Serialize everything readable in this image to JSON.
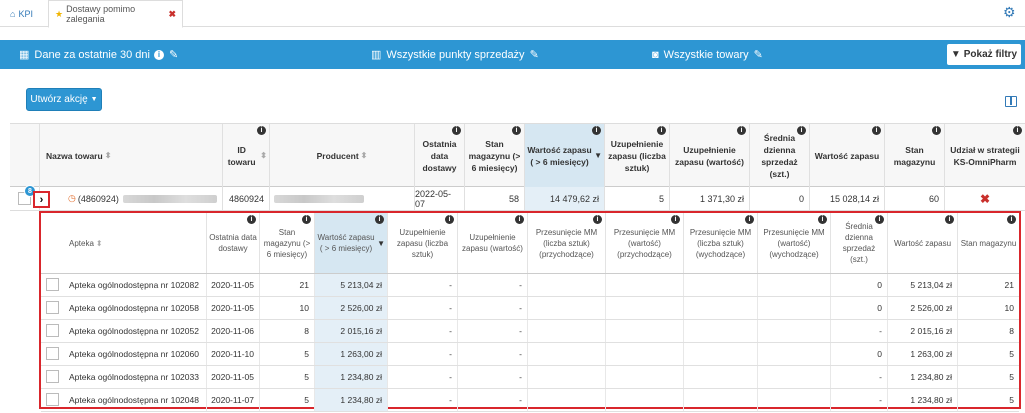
{
  "tabs": [
    {
      "icon": "home-icon",
      "label": "KPI"
    },
    {
      "icon": "star-icon",
      "label": "Dostawy pomimo zalegania"
    }
  ],
  "filterbar": {
    "period": "Dane za ostatnie 30 dni",
    "points": "Wszystkie punkty sprzedaży",
    "products": "Wszystkie towary",
    "show_filters": "Pokaż filtry"
  },
  "action_button": "Utwórz akcję",
  "main_table": {
    "headers": [
      "Nazwa towaru",
      "ID towaru",
      "Producent",
      "Ostatnia data dostawy",
      "Stan magazynu (> 6 miesięcy)",
      "Wartość zapasu ( > 6 miesięcy)",
      "Uzupełnienie zapasu (liczba sztuk)",
      "Uzupełnienie zapasu (wartość)",
      "Średnia dzienna sprzedaż (szt.)",
      "Wartość zapasu",
      "Stan magazynu",
      "Udział w strategii KS-OmniPharm"
    ],
    "row": {
      "badge": "8",
      "name": "(4860924)",
      "id": "4860924",
      "last_delivery": "2022-05-07",
      "stock_6m": "58",
      "value_6m": "14 479,62 zł",
      "replenish_qty": "5",
      "replenish_value": "1 371,30 zł",
      "avg_daily_sales": "0",
      "stock_value": "15 028,14 zł",
      "stock": "60"
    }
  },
  "sub_table": {
    "headers": [
      "Apteka",
      "Ostatnia data dostawy",
      "Stan magazynu (> 6 miesięcy)",
      "Wartość zapasu ( > 6 miesięcy)",
      "Uzupełnienie zapasu (liczba sztuk)",
      "Uzupełnienie zapasu (wartość)",
      "Przesunięcie MM (liczba sztuk) (przychodzące)",
      "Przesunięcie MM (wartość) (przychodzące)",
      "Przesunięcie MM (liczba sztuk) (wychodzące)",
      "Przesunięcie MM (wartość) (wychodzące)",
      "Średnia dzienna sprzedaż (szt.)",
      "Wartość zapasu",
      "Stan magazynu"
    ],
    "rows": [
      {
        "pharmacy": "Apteka ogólnodostępna nr 102082",
        "date": "2020-11-05",
        "stock6": "21",
        "val6": "5 213,04 zł",
        "rq": "-",
        "rv": "-",
        "avg": "0",
        "val": "5 213,04 zł",
        "stock": "21"
      },
      {
        "pharmacy": "Apteka ogólnodostępna nr 102058",
        "date": "2020-11-05",
        "stock6": "10",
        "val6": "2 526,00 zł",
        "rq": "-",
        "rv": "-",
        "avg": "0",
        "val": "2 526,00 zł",
        "stock": "10"
      },
      {
        "pharmacy": "Apteka ogólnodostępna nr 102052",
        "date": "2020-11-06",
        "stock6": "8",
        "val6": "2 015,16 zł",
        "rq": "-",
        "rv": "-",
        "avg": "-",
        "val": "2 015,16 zł",
        "stock": "8"
      },
      {
        "pharmacy": "Apteka ogólnodostępna nr 102060",
        "date": "2020-11-10",
        "stock6": "5",
        "val6": "1 263,00 zł",
        "rq": "-",
        "rv": "-",
        "avg": "0",
        "val": "1 263,00 zł",
        "stock": "5"
      },
      {
        "pharmacy": "Apteka ogólnodostępna nr 102033",
        "date": "2020-11-05",
        "stock6": "5",
        "val6": "1 234,80 zł",
        "rq": "-",
        "rv": "-",
        "avg": "-",
        "val": "1 234,80 zł",
        "stock": "5"
      },
      {
        "pharmacy": "Apteka ogólnodostępna nr 102048",
        "date": "2020-11-07",
        "stock6": "5",
        "val6": "1 234,80 zł",
        "rq": "-",
        "rv": "-",
        "avg": "-",
        "val": "1 234,80 zł",
        "stock": "5"
      }
    ]
  },
  "colors": {
    "accent": "#2d96d3",
    "highlight": "#d9262c",
    "sorted_bg": "#d6e7f2"
  }
}
